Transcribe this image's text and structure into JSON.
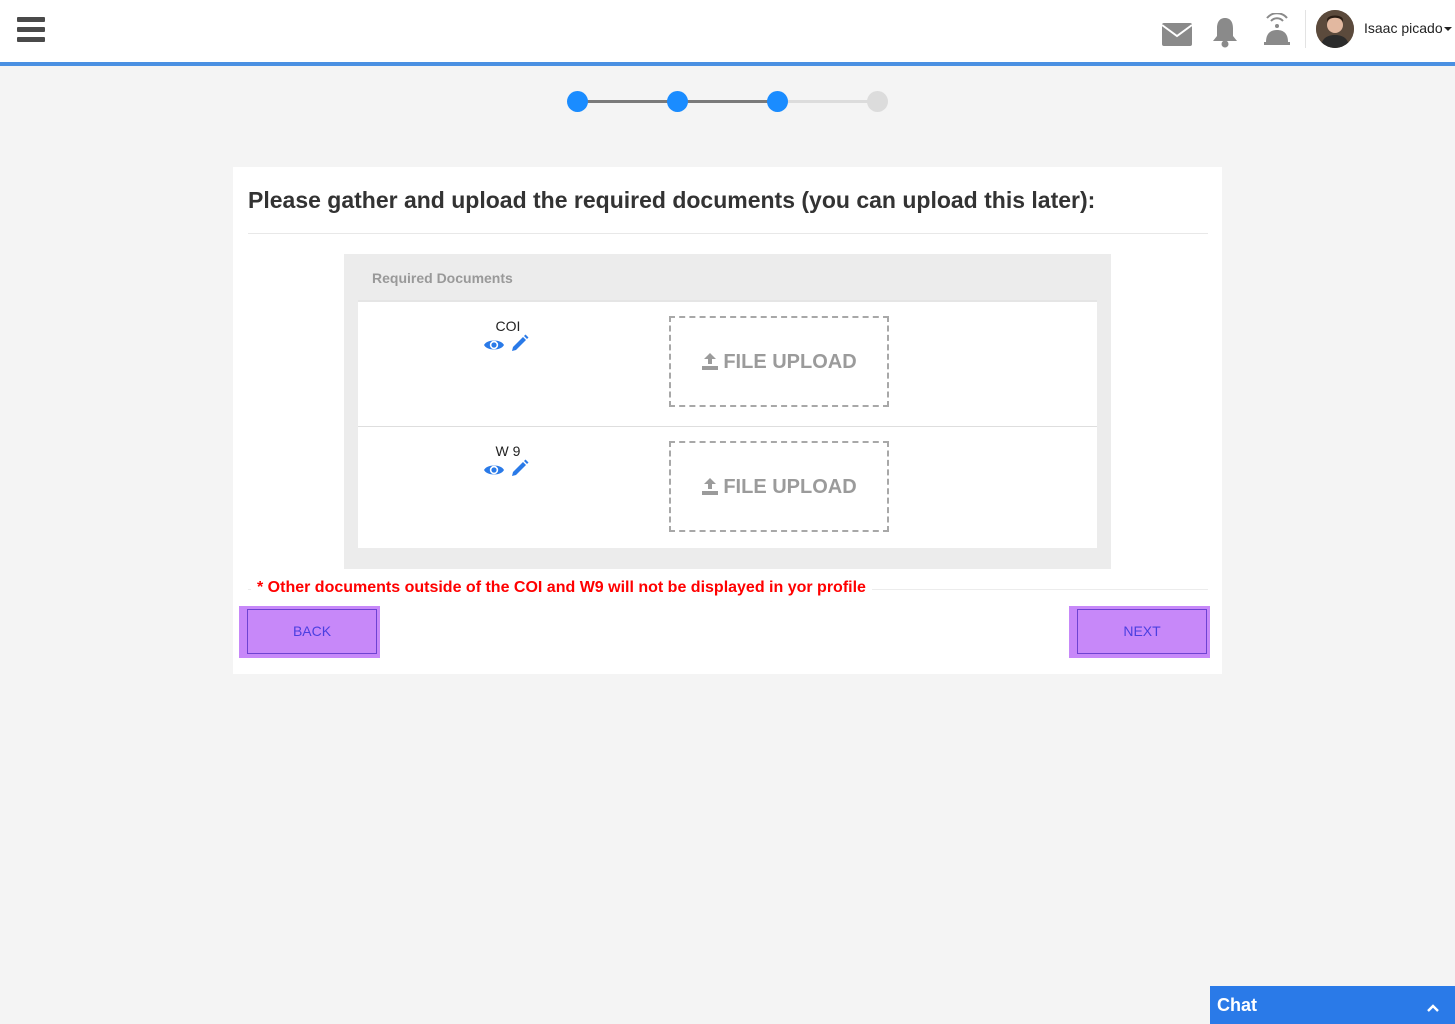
{
  "header": {
    "user_name": "Isaac picado"
  },
  "icons": {
    "menu": "hamburger-menu-icon",
    "mail": "envelope-icon",
    "notifications": "bell-icon",
    "service": "service-bell-icon"
  },
  "stepper": {
    "total_steps": 4,
    "completed_steps": 3,
    "active_color": "#1a8cff",
    "inactive_color": "#dcdcdc"
  },
  "main": {
    "title": "Please gather and upload the required documents (you can upload this later):",
    "panel_title": "Required Documents",
    "documents": [
      {
        "name": "COI",
        "upload_label": "FILE UPLOAD"
      },
      {
        "name": "W 9",
        "upload_label": "FILE UPLOAD"
      }
    ],
    "note": "* Other documents outside of the COI and W9 will not be displayed in yor profile"
  },
  "actions": {
    "back_label": "BACK",
    "next_label": "NEXT"
  },
  "chat": {
    "label": "Chat"
  },
  "colors": {
    "accent": "#4a90e2",
    "link_blue": "#2a7ae8",
    "warning": "#ff0000",
    "button_bg": "#c788f9"
  }
}
